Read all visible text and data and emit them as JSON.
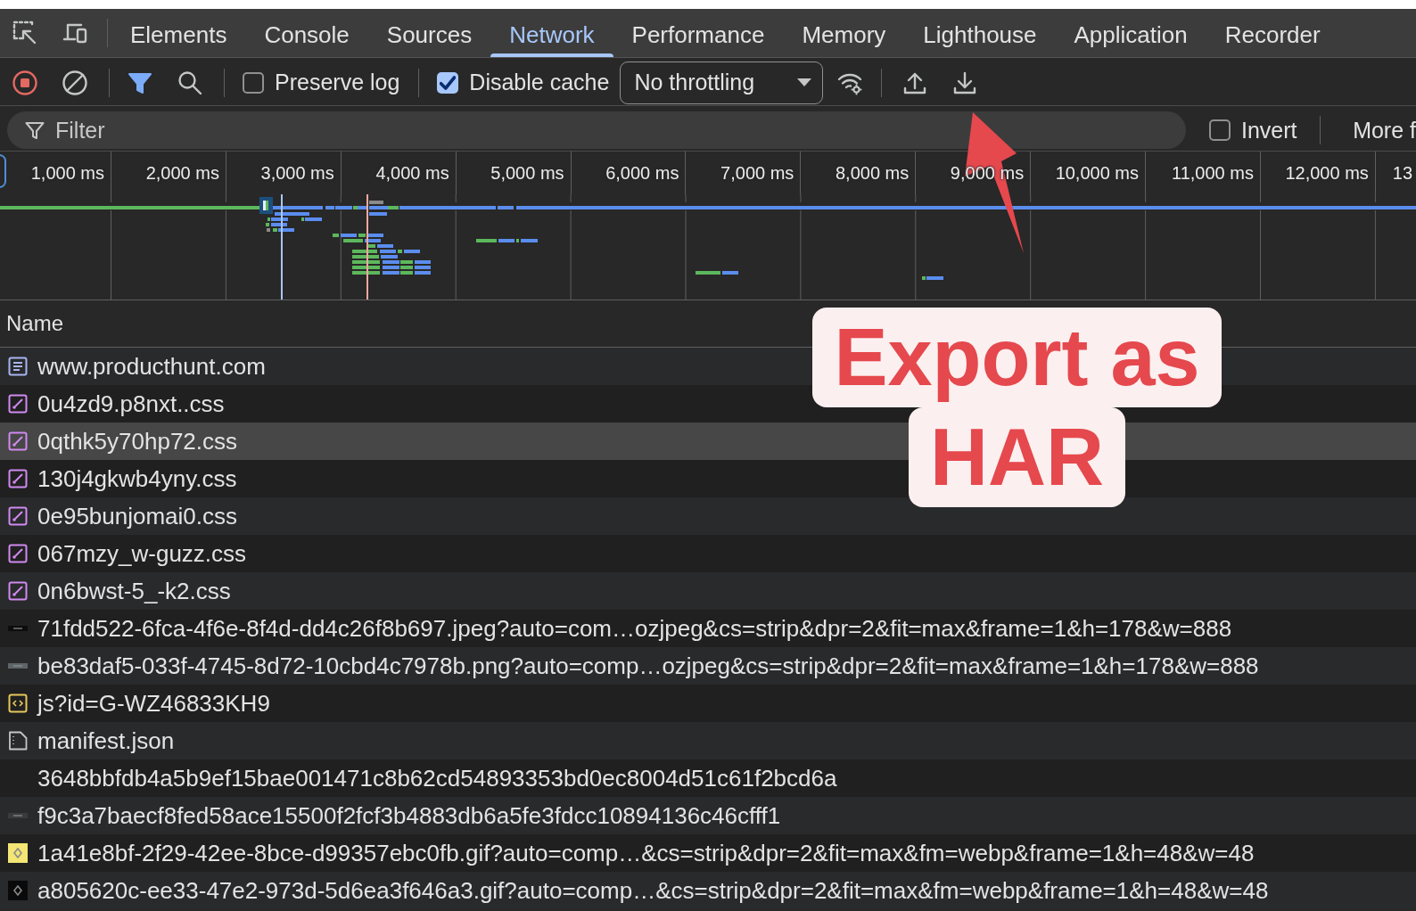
{
  "tabs": [
    {
      "label": "Elements",
      "selected": false
    },
    {
      "label": "Console",
      "selected": false
    },
    {
      "label": "Sources",
      "selected": false
    },
    {
      "label": "Network",
      "selected": true
    },
    {
      "label": "Performance",
      "selected": false
    },
    {
      "label": "Memory",
      "selected": false
    },
    {
      "label": "Lighthouse",
      "selected": false
    },
    {
      "label": "Application",
      "selected": false
    },
    {
      "label": "Recorder",
      "selected": false
    }
  ],
  "toolbar": {
    "recording": true,
    "filter_active": true,
    "preserve_log": {
      "label": "Preserve log",
      "checked": false
    },
    "disable_cache": {
      "label": "Disable cache",
      "checked": true
    },
    "throttling": {
      "value": "No throttling"
    }
  },
  "filter_bar": {
    "placeholder": "Filter",
    "invert": {
      "label": "Invert",
      "checked": false
    },
    "more_filters": "More f"
  },
  "timeline": {
    "ticks": [
      "1,000 ms",
      "2,000 ms",
      "3,000 ms",
      "4,000 ms",
      "5,000 ms",
      "6,000 ms",
      "7,000 ms",
      "8,000 ms",
      "9,000 ms",
      "10,000 ms",
      "11,000 ms",
      "12,000 ms",
      "13"
    ]
  },
  "table": {
    "columns": [
      "Name"
    ],
    "rows": [
      {
        "name": "www.producthunt.com",
        "kind": "document",
        "selected": false
      },
      {
        "name": "0u4zd9.p8nxt..css",
        "kind": "stylesheet",
        "selected": false
      },
      {
        "name": "0qthk5y70hp72.css",
        "kind": "stylesheet",
        "selected": true
      },
      {
        "name": "130j4gkwb4yny.css",
        "kind": "stylesheet",
        "selected": false
      },
      {
        "name": "0e95bunjomai0.css",
        "kind": "stylesheet",
        "selected": false
      },
      {
        "name": "067mzy_w-guzz.css",
        "kind": "stylesheet",
        "selected": false
      },
      {
        "name": "0n6bwst-5_-k2.css",
        "kind": "stylesheet",
        "selected": false
      },
      {
        "name": "71fdd522-6fca-4f6e-8f4d-dd4c26f8b697.jpeg?auto=com…ozjpeg&cs=strip&dpr=2&fit=max&frame=1&h=178&w=888",
        "kind": "image-wide",
        "color": "#0d0d0d",
        "selected": false
      },
      {
        "name": "be83daf5-033f-4745-8d72-10cbd4c7978b.png?auto=comp…ozjpeg&cs=strip&dpr=2&fit=max&frame=1&h=178&w=888",
        "kind": "image-wide",
        "color": "#5f6468",
        "selected": false
      },
      {
        "name": "js?id=G-WZ46833KH9",
        "kind": "script",
        "selected": false
      },
      {
        "name": "manifest.json",
        "kind": "manifest",
        "selected": false
      },
      {
        "name": "3648bbfdb4a5b9ef15bae001471c8b62cd54893353bd0ec8004d51c61f2bcd6a",
        "kind": "other",
        "selected": false
      },
      {
        "name": "f9c3a7baecf8fed58ace15500f2fcf3b4883db6a5fe3fdcc10894136c46cfff1",
        "kind": "image-wide",
        "color": "#3a3b3d",
        "selected": false
      },
      {
        "name": "1a41e8bf-2f29-42ee-8bce-d99357ebc0fb.gif?auto=comp…&cs=strip&dpr=2&fit=max&fm=webp&frame=1&h=48&w=48",
        "kind": "image-square",
        "color": "#f3e675",
        "selected": false
      },
      {
        "name": "a805620c-ee33-47e2-973d-5d6ea3f646a3.gif?auto=comp…&cs=strip&dpr=2&fit=max&fm=webp&frame=1&h=48&w=48",
        "kind": "image-square",
        "color": "#0a0a0a",
        "selected": false
      }
    ]
  },
  "annotation": {
    "lines": [
      "Export as",
      "HAR"
    ]
  }
}
